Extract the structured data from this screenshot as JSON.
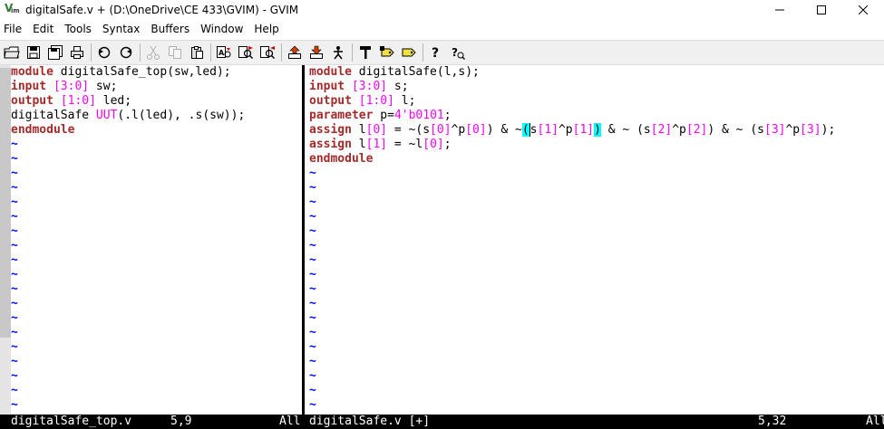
{
  "window": {
    "title": "digitalSafe.v + (D:\\OneDrive\\CE 433\\GVIM) - GVIM",
    "icon": "vim-icon",
    "controls": [
      "minimize-icon",
      "maximize-icon",
      "close-icon"
    ]
  },
  "menu": {
    "items": [
      "File",
      "Edit",
      "Tools",
      "Syntax",
      "Buffers",
      "Window",
      "Help"
    ]
  },
  "toolbar": {
    "buttons": [
      {
        "name": "open-icon",
        "enabled": true
      },
      {
        "name": "save-icon",
        "enabled": true
      },
      {
        "name": "save-all-icon",
        "enabled": true
      },
      {
        "name": "print-icon",
        "enabled": true
      },
      {
        "name": "undo-icon",
        "enabled": true
      },
      {
        "name": "redo-icon",
        "enabled": true
      },
      {
        "name": "cut-icon",
        "enabled": false
      },
      {
        "name": "copy-icon",
        "enabled": false
      },
      {
        "name": "paste-icon",
        "enabled": true
      },
      {
        "name": "replace-icon",
        "enabled": true
      },
      {
        "name": "find-next-icon",
        "enabled": true
      },
      {
        "name": "find-prev-icon",
        "enabled": true
      },
      {
        "name": "load-session-icon",
        "enabled": true
      },
      {
        "name": "save-session-icon",
        "enabled": true
      },
      {
        "name": "run-script-icon",
        "enabled": true
      },
      {
        "name": "make-icon",
        "enabled": true
      },
      {
        "name": "build-tags-icon",
        "enabled": true
      },
      {
        "name": "jump-tag-icon",
        "enabled": true
      },
      {
        "name": "help-icon",
        "enabled": true
      },
      {
        "name": "find-help-icon",
        "enabled": true
      }
    ]
  },
  "colors": {
    "keyword": "#a52a2a",
    "number": "#ff00ff",
    "tilde": "#0000ff",
    "match_highlight": "#00ffff",
    "status_bg": "#000000",
    "status_fg": "#ffffff"
  },
  "left_pane": {
    "lines": [
      [
        {
          "t": "module",
          "c": "kw"
        },
        {
          "t": " digitalSafe_top(sw,led);",
          "c": "id"
        }
      ],
      [
        {
          "t": "input",
          "c": "kw"
        },
        {
          "t": " ",
          "c": "id"
        },
        {
          "t": "[3:0]",
          "c": "num"
        },
        {
          "t": " sw;",
          "c": "id"
        }
      ],
      [
        {
          "t": "output",
          "c": "kw"
        },
        {
          "t": " ",
          "c": "id"
        },
        {
          "t": "[1:0]",
          "c": "num"
        },
        {
          "t": " led;",
          "c": "id"
        }
      ],
      [
        {
          "t": "digitalSafe ",
          "c": "id"
        },
        {
          "t": "UUT",
          "c": "num"
        },
        {
          "t": "(.l(led), .s(sw));",
          "c": "id"
        }
      ],
      [
        {
          "t": "endmodule",
          "c": "kw"
        }
      ]
    ],
    "tilde_count": 19
  },
  "right_pane": {
    "lines": [
      [
        {
          "t": "module",
          "c": "kw"
        },
        {
          "t": " digitalSafe(l,s);",
          "c": "id"
        }
      ],
      [
        {
          "t": "input",
          "c": "kw"
        },
        {
          "t": " ",
          "c": "id"
        },
        {
          "t": "[3:0]",
          "c": "num"
        },
        {
          "t": " s;",
          "c": "id"
        }
      ],
      [
        {
          "t": "output",
          "c": "kw"
        },
        {
          "t": " ",
          "c": "id"
        },
        {
          "t": "[1:0]",
          "c": "num"
        },
        {
          "t": " l;",
          "c": "id"
        }
      ],
      [
        {
          "t": "parameter",
          "c": "kw"
        },
        {
          "t": " p=",
          "c": "id"
        },
        {
          "t": "4'b0101",
          "c": "num"
        },
        {
          "t": ";",
          "c": "id"
        }
      ],
      [
        {
          "t": "assign",
          "c": "kw"
        },
        {
          "t": " l",
          "c": "id"
        },
        {
          "t": "[0]",
          "c": "num"
        },
        {
          "t": " = ~(s",
          "c": "id"
        },
        {
          "t": "[0]",
          "c": "num"
        },
        {
          "t": "^p",
          "c": "id"
        },
        {
          "t": "[0]",
          "c": "num"
        },
        {
          "t": ") & ~",
          "c": "id"
        },
        {
          "t": "(",
          "c": "id hl"
        },
        {
          "t": "s",
          "c": "id cursor"
        },
        {
          "t": "[1]",
          "c": "num"
        },
        {
          "t": "^p",
          "c": "id"
        },
        {
          "t": "[1]",
          "c": "num"
        },
        {
          "t": ")",
          "c": "id hl"
        },
        {
          "t": " & ~ (s",
          "c": "id"
        },
        {
          "t": "[2]",
          "c": "num"
        },
        {
          "t": "^p",
          "c": "id"
        },
        {
          "t": "[2]",
          "c": "num"
        },
        {
          "t": ") & ~ (s",
          "c": "id"
        },
        {
          "t": "[3]",
          "c": "num"
        },
        {
          "t": "^p",
          "c": "id"
        },
        {
          "t": "[3]",
          "c": "num"
        },
        {
          "t": ");",
          "c": "id"
        }
      ],
      [
        {
          "t": "assign",
          "c": "kw"
        },
        {
          "t": " l",
          "c": "id"
        },
        {
          "t": "[1]",
          "c": "num"
        },
        {
          "t": " = ~l",
          "c": "id"
        },
        {
          "t": "[0]",
          "c": "num"
        },
        {
          "t": ";",
          "c": "id"
        }
      ],
      [
        {
          "t": "endmodule",
          "c": "kw"
        }
      ]
    ],
    "tilde_count": 17
  },
  "status": {
    "left_file": "digitalSafe_top.v",
    "left_pos": "5,9",
    "left_scroll": "All",
    "right_file": "digitalSafe.v [+]",
    "right_pos": "5,32",
    "right_scroll": "All"
  }
}
